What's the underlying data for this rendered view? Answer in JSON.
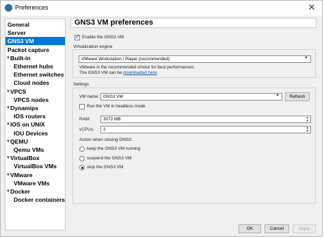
{
  "window": {
    "title": "Preferences"
  },
  "tree": {
    "items": [
      {
        "label": "General",
        "indent": 0,
        "arrow": false,
        "selected": false
      },
      {
        "label": "Server",
        "indent": 0,
        "arrow": false,
        "selected": false
      },
      {
        "label": "GNS3 VM",
        "indent": 0,
        "arrow": false,
        "selected": true
      },
      {
        "label": "Packet capture",
        "indent": 0,
        "arrow": false,
        "selected": false
      },
      {
        "label": "Built-in",
        "indent": 0,
        "arrow": true,
        "selected": false
      },
      {
        "label": "Ethernet hubs",
        "indent": 1,
        "arrow": false,
        "selected": false
      },
      {
        "label": "Ethernet switches",
        "indent": 1,
        "arrow": false,
        "selected": false
      },
      {
        "label": "Cloud nodes",
        "indent": 1,
        "arrow": false,
        "selected": false
      },
      {
        "label": "VPCS",
        "indent": 0,
        "arrow": true,
        "selected": false
      },
      {
        "label": "VPCS nodes",
        "indent": 1,
        "arrow": false,
        "selected": false
      },
      {
        "label": "Dynamips",
        "indent": 0,
        "arrow": true,
        "selected": false
      },
      {
        "label": "IOS routers",
        "indent": 1,
        "arrow": false,
        "selected": false
      },
      {
        "label": "IOS on UNIX",
        "indent": 0,
        "arrow": true,
        "selected": false
      },
      {
        "label": "IOU Devices",
        "indent": 1,
        "arrow": false,
        "selected": false
      },
      {
        "label": "QEMU",
        "indent": 0,
        "arrow": true,
        "selected": false
      },
      {
        "label": "Qemu VMs",
        "indent": 1,
        "arrow": false,
        "selected": false
      },
      {
        "label": "VirtualBox",
        "indent": 0,
        "arrow": true,
        "selected": false
      },
      {
        "label": "VirtualBox VMs",
        "indent": 1,
        "arrow": false,
        "selected": false
      },
      {
        "label": "VMware",
        "indent": 0,
        "arrow": true,
        "selected": false
      },
      {
        "label": "VMware VMs",
        "indent": 1,
        "arrow": false,
        "selected": false
      },
      {
        "label": "Docker",
        "indent": 0,
        "arrow": true,
        "selected": false
      },
      {
        "label": "Docker containers",
        "indent": 1,
        "arrow": false,
        "selected": false
      }
    ]
  },
  "page": {
    "title": "GNS3 VM preferences",
    "enable_label": "Enable the GNS3 VM",
    "enable_checked": true,
    "virt_group_title": "Virtualization engine",
    "engine_value": "VMware Workstation / Player (recommended)",
    "engine_note_1": "VMware is the recommended choice for best performances.",
    "engine_note_2_prefix": "The GNS3 VM can be ",
    "engine_note_2_link": "downloaded here",
    "engine_note_2_suffix": ".",
    "settings_group_title": "Settings",
    "vm_name_label": "VM name:",
    "vm_name_value": "GNS3 VM",
    "refresh_label": "Refresh",
    "headless_label": "Run the VM in headless mode",
    "headless_checked": false,
    "ram_label": "RAM:",
    "ram_value": "3072 MB",
    "vcpus_label": "vCPUs:",
    "vcpus_value": "2",
    "closing_label": "Action when closing GNS3:",
    "radio_options": [
      {
        "label": "keep the GNS3 VM running",
        "checked": false
      },
      {
        "label": "suspend the GNS3 VM",
        "checked": false
      },
      {
        "label": "stop the GNS3 VM",
        "checked": true
      }
    ]
  },
  "buttons": {
    "ok": "OK",
    "cancel": "Cancel",
    "apply": "Apply"
  },
  "colors": {
    "selection": "#0078d7",
    "link": "#0a56b8"
  },
  "icons": [
    "app-icon",
    "close-icon",
    "expand-arrow-icon",
    "dropdown-arrow-icon",
    "spin-arrows-icon"
  ]
}
